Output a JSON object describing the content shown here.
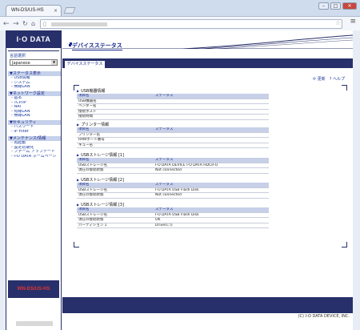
{
  "browser": {
    "tab_title": "WN-DS/US-HS",
    "tab_close": "×",
    "buttons": {
      "minimize": "–",
      "maximize": "□",
      "close": "✕"
    }
  },
  "sidebar": {
    "logo": "I·O DATA",
    "language": {
      "title": "言語選択",
      "value": "Japanese"
    },
    "groups": [
      {
        "head": "▼ステータス表示",
        "items": [
          "- USB情報",
          "- システム",
          "- 無線LAN"
        ]
      },
      {
        "head": "▼ネットワーク設定",
        "items": [
          "- 基本",
          "- TCP/IP",
          "- NAT",
          "- 有線LAN",
          "- 無線LAN"
        ]
      },
      {
        "head": "▼セキュリティ",
        "items": [
          "- パスワード",
          "- IP Filter"
        ]
      },
      {
        "head": "▼メンテナンス/情報",
        "items": [
          "- 再起動",
          "- 設定初期化",
          "- ファーム アップデート",
          "- I-O DATA ホームページ"
        ]
      }
    ],
    "model": "WN-DS/US-HS"
  },
  "main": {
    "title": "デバイスステータス",
    "tab": "デバイスステータス",
    "refresh": "更新",
    "help": "ヘルプ",
    "copyright": "(C) I-O DATA DEVICE, INC."
  },
  "sections": [
    {
      "title": "USB機器情報",
      "headers": [
        "項目名",
        "ステータス"
      ],
      "rows": [
        [
          "USB機器名",
          ""
        ],
        [
          "ベンダー名",
          ""
        ],
        [
          "接続ホスト",
          ""
        ],
        [
          "接続時間",
          ""
        ]
      ]
    },
    {
      "title": "プリンター情報",
      "headers": [
        "項目名",
        "ステータス"
      ],
      "rows": [
        [
          "プリンター名",
          ""
        ],
        [
          "RAWポート番号",
          ""
        ],
        [
          "キュー名",
          ""
        ]
      ]
    },
    {
      "title": "USBストレージ情報 [1]",
      "headers": [
        "項目名",
        "ステータス"
      ],
      "rows": [
        [
          "USBストレージ名",
          "I-O DATA DEVICE I-O DATA HDCR-U"
        ],
        [
          "現在の接続状態",
          "Not connected"
        ]
      ]
    },
    {
      "title": "USBストレージ情報 [2]",
      "headers": [
        "項目名",
        "ステータス"
      ],
      "rows": [
        [
          "USBストレージ名",
          "I-O DATA USB Flash Disk"
        ],
        [
          "現在の接続状態",
          "Not connected"
        ]
      ]
    },
    {
      "title": "USBストレージ情報 [3]",
      "headers": [
        "項目名",
        "ステータス"
      ],
      "rows": [
        [
          "USBストレージ名",
          "I-O DATA USB Flash Disk"
        ],
        [
          "現在の接続状態",
          "OK"
        ],
        [
          "パーティション 1",
          "Drive(C:\\)"
        ]
      ]
    }
  ]
}
